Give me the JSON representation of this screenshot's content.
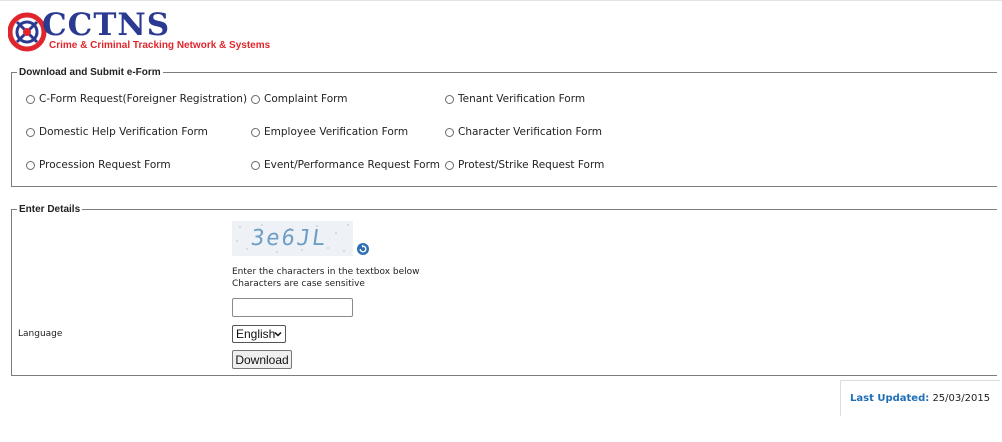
{
  "logo": {
    "title": "CCTNS",
    "subtitle": "Crime & Criminal Tracking Network & Systems",
    "colors": {
      "blue": "#2b3a91",
      "red": "#e0262d"
    }
  },
  "eform": {
    "legend": "Download and Submit e-Form",
    "options": [
      "C-Form Request(Foreigner Registration)",
      "Complaint Form",
      "Tenant Verification Form",
      "Domestic Help Verification Form",
      "Employee Verification Form",
      "Character Verification Form",
      "Procession Request Form",
      "Event/Performance Request Form",
      "Protest/Strike Request Form"
    ]
  },
  "details": {
    "legend": "Enter Details",
    "captcha_text": "3e6JL",
    "hint_line1": "Enter the characters in the textbox below",
    "hint_line2": "Characters are case sensitive",
    "captcha_value": "",
    "language_label": "Language",
    "language_selected": "English",
    "download_label": "Download"
  },
  "footer": {
    "last_updated_label": "Last Updated:",
    "last_updated_value": "25/03/2015"
  },
  "icons": [
    "cctns-emblem-icon",
    "refresh-icon",
    "chevron-down-icon"
  ]
}
